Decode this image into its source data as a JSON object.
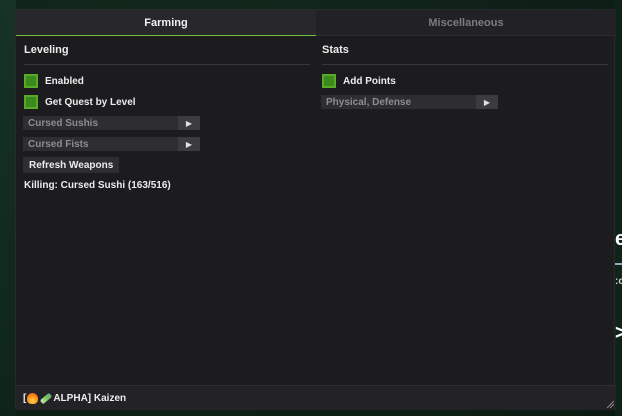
{
  "tabs": [
    {
      "label": "Farming",
      "active": true
    },
    {
      "label": "Miscellaneous",
      "active": false
    }
  ],
  "left": {
    "title": "Leveling",
    "toggles": [
      {
        "label": "Enabled",
        "checked": true
      },
      {
        "label": "Get Quest by Level",
        "checked": true
      }
    ],
    "dropdowns": [
      {
        "value": "Cursed Sushis"
      },
      {
        "value": "Cursed Fists"
      }
    ],
    "refresh_button": "Refresh Weapons",
    "status": "Killing: Cursed Sushi (163/516)"
  },
  "right": {
    "title": "Stats",
    "toggle": {
      "label": "Add Points",
      "checked": true
    },
    "dropdown": {
      "value": "Physical, Defense"
    }
  },
  "footer": {
    "prefix": "[",
    "suffix": "ALPHA] Kaizen",
    "icons": [
      "fire-icon",
      "syringe-icon"
    ]
  },
  "colors": {
    "accent": "#6fbf3c",
    "checkbox_fill": "#3b8a1e",
    "window_bg": "#1c1b1e"
  }
}
